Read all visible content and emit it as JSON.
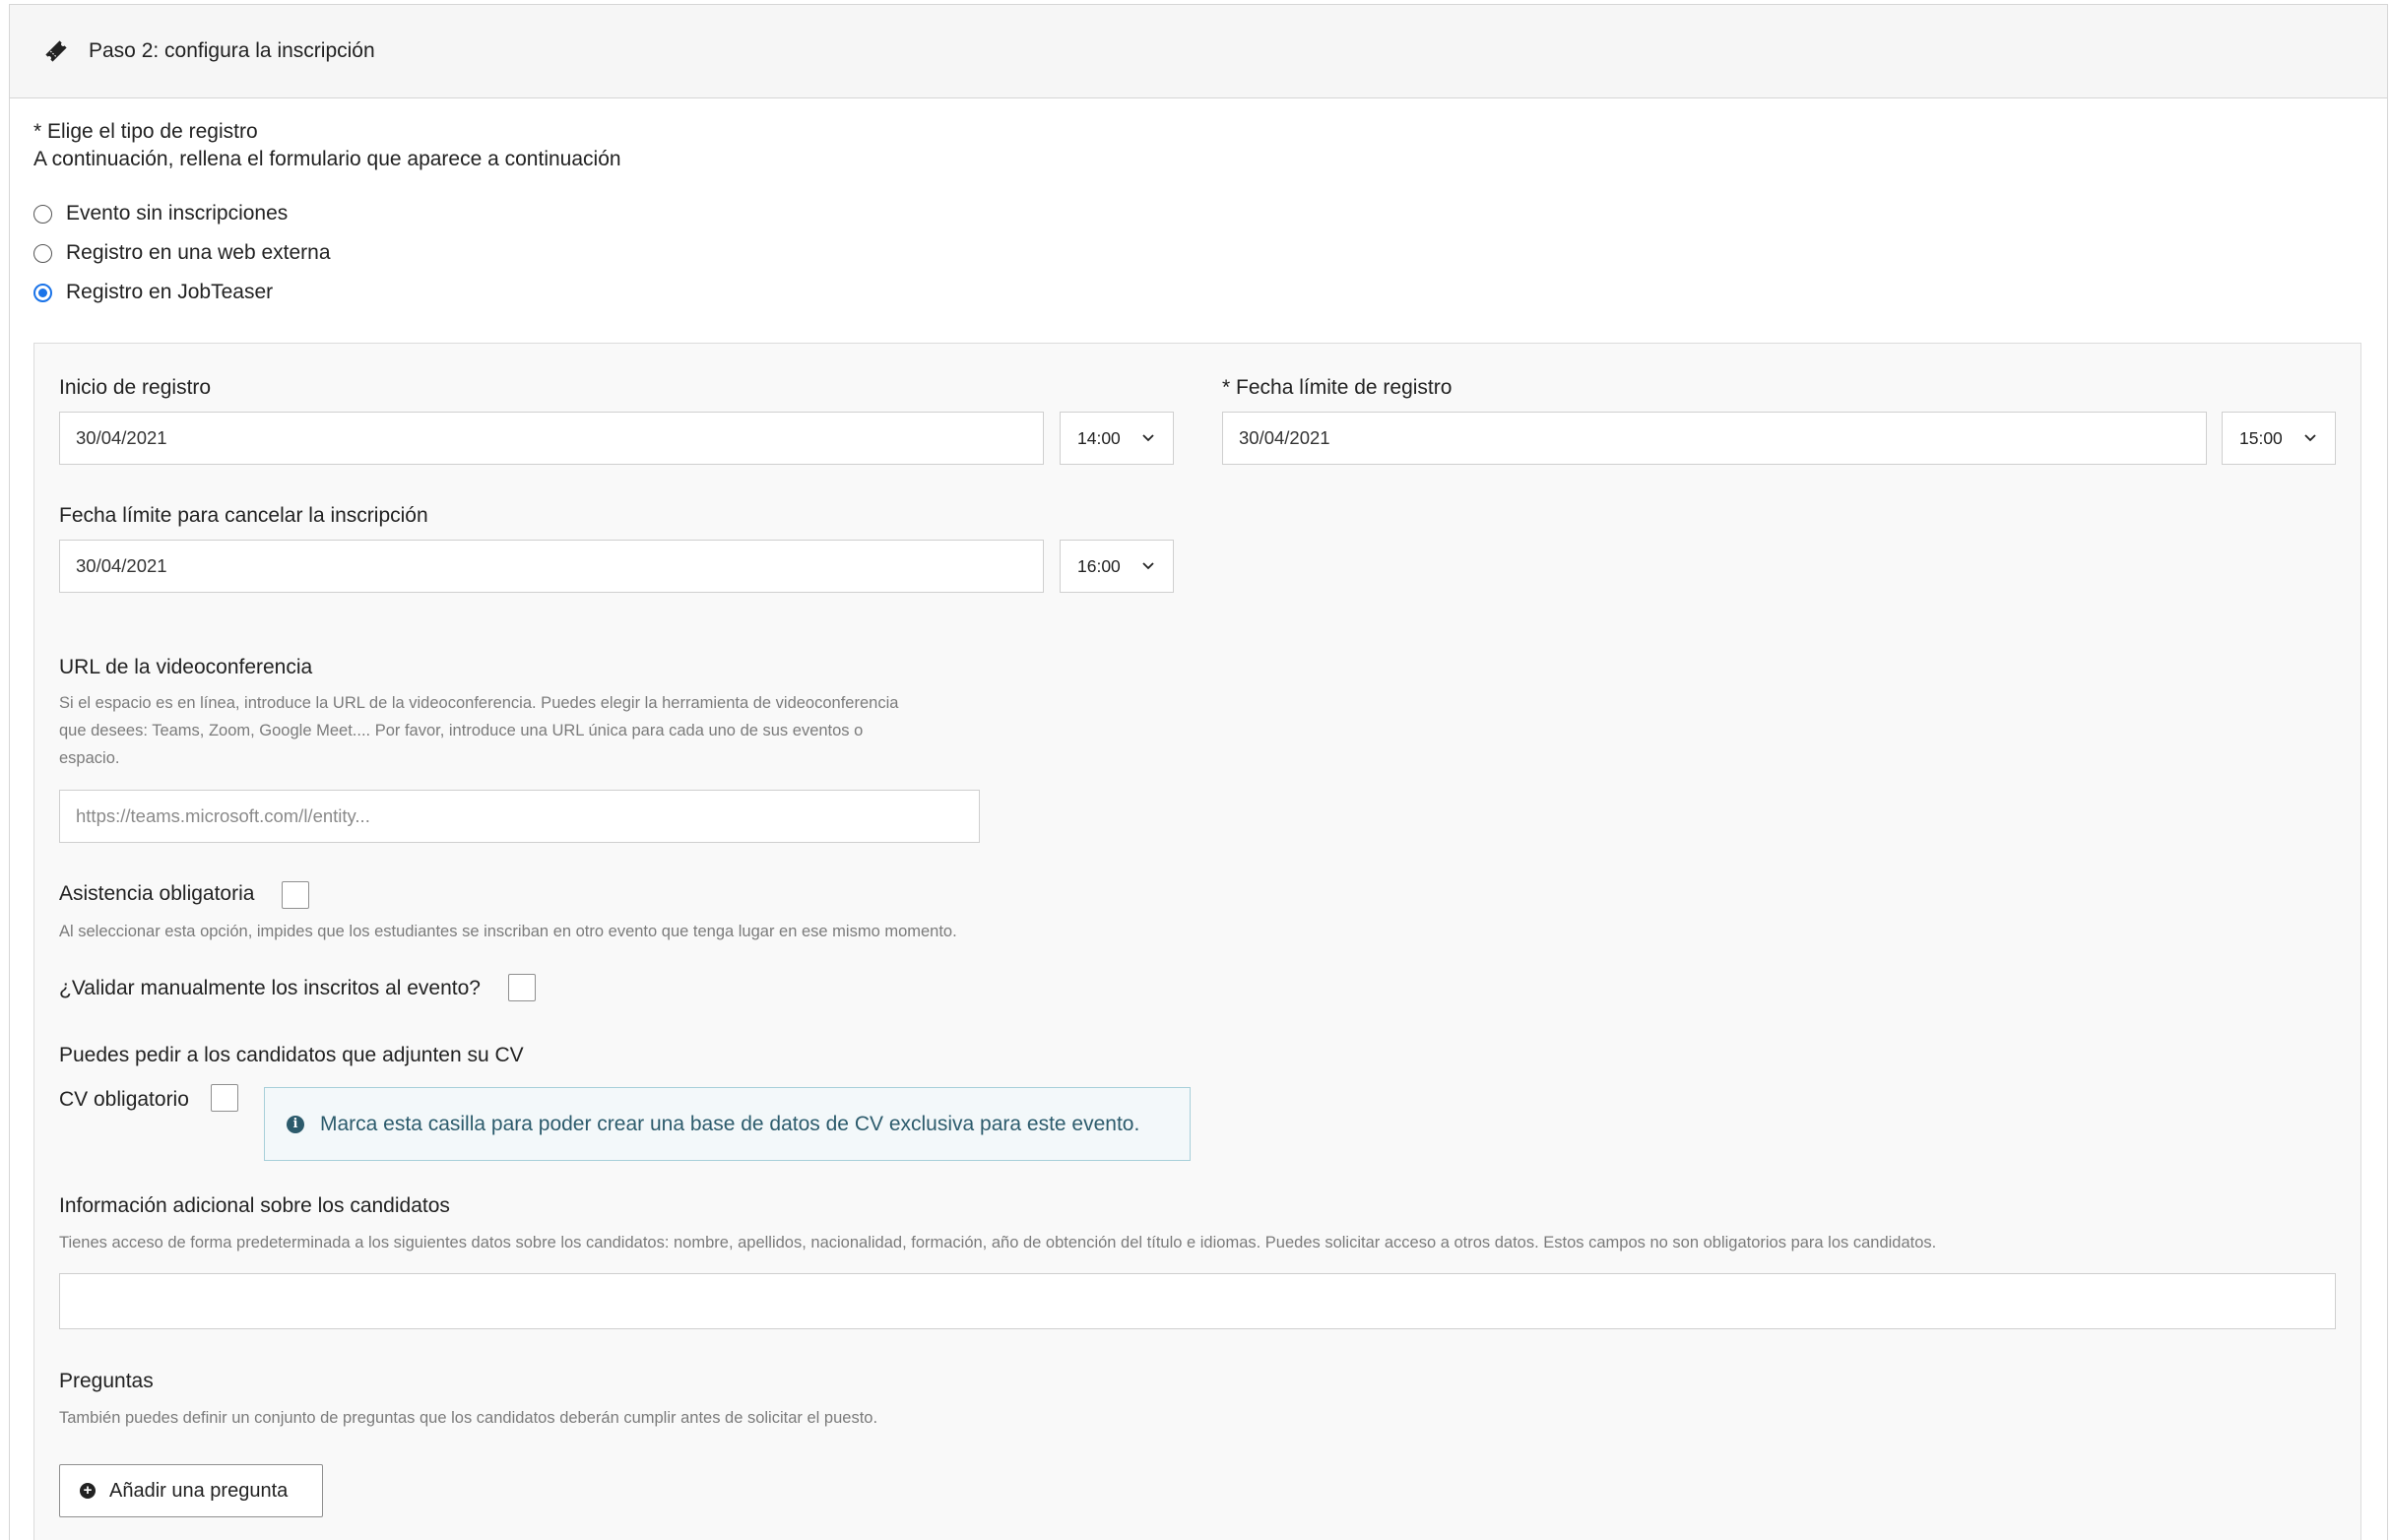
{
  "header": {
    "title": "Paso 2: configura la inscripción",
    "icon": "ticket-icon"
  },
  "registration_type": {
    "label": "* Elige el tipo de registro",
    "subtitle": "A continuación, rellena el formulario que aparece a continuación",
    "options": [
      {
        "label": "Evento sin inscripciones",
        "checked": false
      },
      {
        "label": "Registro en una web externa",
        "checked": false
      },
      {
        "label": "Registro en JobTeaser",
        "checked": true
      }
    ]
  },
  "form": {
    "start": {
      "label": "Inicio de registro",
      "date": "30/04/2021",
      "time": "14:00"
    },
    "deadline": {
      "label": "* Fecha límite de registro",
      "date": "30/04/2021",
      "time": "15:00"
    },
    "cancel": {
      "label": "Fecha límite para cancelar la inscripción",
      "date": "30/04/2021",
      "time": "16:00"
    },
    "video": {
      "label": "URL de la videoconferencia",
      "hint_lines": [
        "Si el espacio es en línea, introduce la URL de la videoconferencia. Puedes elegir la herramienta de videoconferencia",
        "que desees: Teams, Zoom, Google Meet.... Por favor, introduce una URL única para cada uno de sus eventos o",
        "espacio."
      ],
      "placeholder": "https://teams.microsoft.com/l/entity..."
    },
    "mandatory_attendance": {
      "label": "Asistencia obligatoria",
      "hint": "Al seleccionar esta opción, impides que los estudiantes se inscriban en otro evento que tenga lugar en ese mismo momento.",
      "checked": false
    },
    "manual_validation": {
      "label": "¿Validar manualmente los inscritos al evento?",
      "checked": false
    },
    "cv": {
      "intro": "Puedes pedir a los candidatos que adjunten su CV",
      "label": "CV obligatorio",
      "checked": false,
      "info": "Marca esta casilla para poder crear una base de datos de CV exclusiva para este evento."
    },
    "additional_info": {
      "label": "Información adicional sobre los candidatos",
      "hint": "Tienes acceso de forma predeterminada a los siguientes datos sobre los candidatos: nombre, apellidos, nacionalidad, formación, año de obtención del título e idiomas. Puedes solicitar acceso a otros datos. Estos campos no son obligatorios para los candidatos.",
      "value": ""
    },
    "questions": {
      "label": "Preguntas",
      "hint": "También puedes definir un conjunto de preguntas que los candidatos deberán cumplir antes de solicitar el puesto.",
      "add_button": "Añadir una pregunta"
    }
  },
  "colors": {
    "accent": "#1a73e8",
    "info_text": "#2c5b6c",
    "info_border": "#a7cfd9",
    "panel_bg": "#f9f9f9"
  }
}
